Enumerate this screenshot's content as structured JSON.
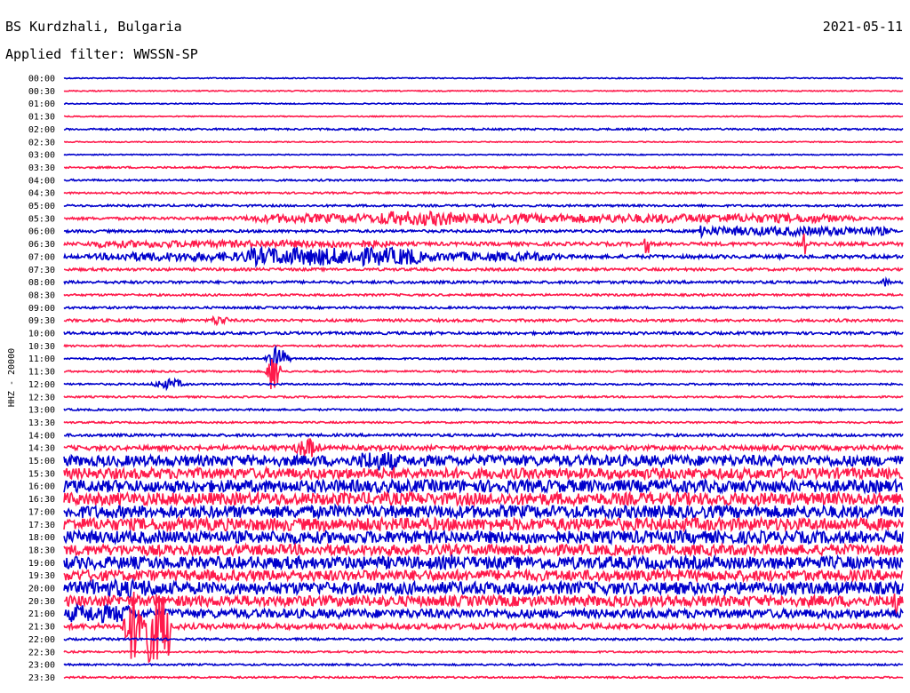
{
  "header": {
    "station": "BS Kurdzhali, Bulgaria",
    "date": "2021-05-11",
    "filter": "Applied filter: WWSSN-SP"
  },
  "chart_data": {
    "type": "line",
    "title": "BS Kurdzhali, Bulgaria",
    "subtitle": "Applied filter: WWSSN-SP",
    "date": "2021-05-11",
    "ylabel": "HHZ - 20000",
    "xlabel": "",
    "row_labels": [
      "00:00",
      "00:30",
      "01:00",
      "01:30",
      "02:00",
      "02:30",
      "03:00",
      "03:30",
      "04:00",
      "04:30",
      "05:00",
      "05:30",
      "06:00",
      "06:30",
      "07:00",
      "07:30",
      "08:00",
      "08:30",
      "09:00",
      "09:30",
      "10:00",
      "10:30",
      "11:00",
      "11:30",
      "12:00",
      "12:30",
      "13:00",
      "13:30",
      "14:00",
      "14:30",
      "15:00",
      "15:30",
      "16:00",
      "16:30",
      "17:00",
      "17:30",
      "18:00",
      "18:30",
      "19:00",
      "19:30",
      "20:00",
      "20:30",
      "21:00",
      "21:30",
      "22:00",
      "22:30",
      "23:00",
      "23:30"
    ],
    "row_colors": [
      "#0000cc",
      "#ff1a4b"
    ],
    "grid": false,
    "noise_amplitude": [
      0.6,
      0.6,
      0.6,
      0.6,
      1.0,
      0.6,
      0.6,
      1.0,
      1.0,
      1.0,
      1.2,
      1.5,
      1.5,
      2.0,
      2.0,
      1.5,
      1.5,
      1.2,
      1.2,
      1.5,
      1.5,
      1.0,
      1.0,
      1.0,
      1.0,
      1.0,
      1.0,
      1.0,
      1.5,
      2.5,
      6,
      6,
      7,
      7,
      7,
      7,
      7,
      6,
      7,
      6,
      7,
      6,
      5,
      3,
      1.2,
      1.0,
      1.0,
      1.0
    ],
    "events": [
      {
        "row": 11,
        "start": 0.17,
        "end": 0.98,
        "amp": 5
      },
      {
        "row": 11,
        "start": 0.37,
        "end": 0.47,
        "amp": 8
      },
      {
        "row": 12,
        "start": 0.75,
        "end": 1.0,
        "amp": 5
      },
      {
        "row": 12,
        "start": 0.755,
        "end": 0.765,
        "amp": 15
      },
      {
        "row": 13,
        "start": 0.0,
        "end": 0.42,
        "amp": 4
      },
      {
        "row": 13,
        "start": 0.69,
        "end": 0.7,
        "amp": 12
      },
      {
        "row": 13,
        "start": 0.88,
        "end": 0.885,
        "amp": 14
      },
      {
        "row": 14,
        "start": 0.0,
        "end": 0.63,
        "amp": 5
      },
      {
        "row": 14,
        "start": 0.2,
        "end": 0.44,
        "amp": 10
      },
      {
        "row": 16,
        "start": 0.97,
        "end": 0.99,
        "amp": 5
      },
      {
        "row": 19,
        "start": 0.17,
        "end": 0.2,
        "amp": 6
      },
      {
        "row": 22,
        "start": 0.24,
        "end": 0.27,
        "amp": 14
      },
      {
        "row": 23,
        "start": 0.24,
        "end": 0.26,
        "amp": 24
      },
      {
        "row": 24,
        "start": 0.1,
        "end": 0.15,
        "amp": 6
      },
      {
        "row": 29,
        "start": 0.27,
        "end": 0.31,
        "amp": 12
      },
      {
        "row": 30,
        "start": 0.35,
        "end": 0.4,
        "amp": 11
      },
      {
        "row": 38,
        "start": 0.45,
        "end": 0.47,
        "amp": 10
      },
      {
        "row": 40,
        "start": 0.02,
        "end": 0.12,
        "amp": 10
      },
      {
        "row": 41,
        "start": 0.98,
        "end": 1.0,
        "amp": 16
      },
      {
        "row": 42,
        "start": 0.0,
        "end": 0.09,
        "amp": 10
      },
      {
        "row": 43,
        "start": 0.07,
        "end": 0.13,
        "amp": 40
      }
    ]
  }
}
